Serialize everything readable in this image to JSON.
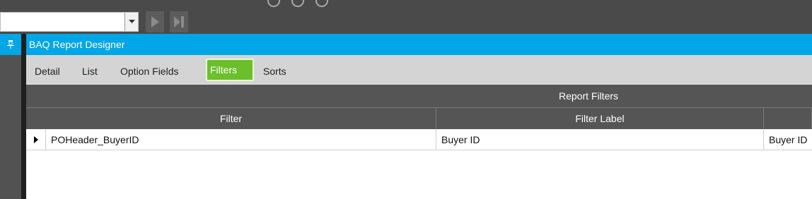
{
  "toolbar": {
    "combo_value": ""
  },
  "panel": {
    "title": "BAQ Report Designer"
  },
  "tabs": [
    {
      "label": "Detail"
    },
    {
      "label": "List"
    },
    {
      "label": "Option Fields"
    },
    {
      "label": "Filters",
      "active": true
    },
    {
      "label": "Sorts"
    }
  ],
  "grid": {
    "band_title": "Report Filters",
    "columns": [
      "Filter",
      "Filter Label",
      ""
    ],
    "rows": [
      {
        "filter": "POHeader_BuyerID",
        "label": "Buyer ID",
        "extra": "Buyer ID"
      }
    ]
  },
  "colors": {
    "accent": "#00a6e6",
    "active_tab": "#6bbf2a",
    "grid_header": "#555555"
  }
}
